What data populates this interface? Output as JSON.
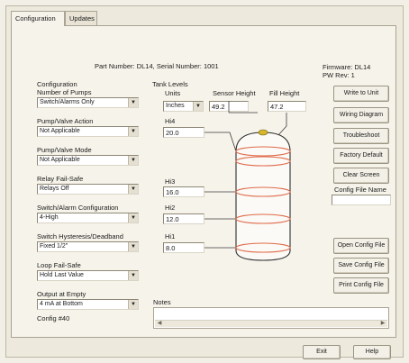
{
  "tabs": [
    {
      "label": "Configuration"
    },
    {
      "label": "Updates"
    }
  ],
  "header": {
    "part_number_label": "Part Number:",
    "part_number": "DL14",
    "serial_label": "Serial Number:",
    "serial_number": "1001",
    "firmware": "Firmware: DL14",
    "pw_rev": "PW Rev: 1"
  },
  "configuration": {
    "title": "Configuration",
    "fields": [
      {
        "label": "Number of Pumps",
        "value": "Switch/Alarms Only"
      },
      {
        "label": "Pump/Valve Action",
        "value": "Not Applicable"
      },
      {
        "label": "Pump/Valve Mode",
        "value": "Not Applicable"
      },
      {
        "label": "Relay Fail-Safe",
        "value": "Relays Off"
      },
      {
        "label": "Switch/Alarm Configuration",
        "value": "4-High"
      },
      {
        "label": "Switch Hysteresis/Deadband",
        "value": "Fixed 1/2\""
      },
      {
        "label": "Loop Fail-Safe",
        "value": "Hold Last Value"
      },
      {
        "label": "Output at Empty",
        "value": "4 mA at Bottom"
      }
    ],
    "config_number": "Config #40"
  },
  "tank": {
    "title": "Tank Levels",
    "units_label": "Units",
    "units_value": "Inches",
    "sensor_height_label": "Sensor Height",
    "sensor_height": "49.2",
    "fill_height_label": "Fill Height",
    "fill_height": "47.2",
    "levels": [
      {
        "label": "Hi4",
        "value": "20.0"
      },
      {
        "label": "Hi3",
        "value": "16.0"
      },
      {
        "label": "Hi2",
        "value": "12.0"
      },
      {
        "label": "Hi1",
        "value": "8.0"
      }
    ]
  },
  "buttons": {
    "write": "Write to Unit",
    "wiring": "Wiring Diagram",
    "troubleshoot": "Troubleshoot",
    "factory": "Factory Default",
    "clear": "Clear Screen",
    "config_file_label": "Config File Name",
    "config_file_value": "",
    "open": "Open Config File",
    "save": "Save Config File",
    "print": "Print Config File",
    "exit": "Exit",
    "help": "Help"
  },
  "notes": {
    "label": "Notes",
    "value": ""
  },
  "icons": {
    "dropdown": "chevron-down-icon",
    "scroll_left": "arrow-left-icon",
    "scroll_right": "arrow-right-icon"
  },
  "colors": {
    "tank_rings": "#e06a4a",
    "tank_cap": "#d8b62a"
  }
}
